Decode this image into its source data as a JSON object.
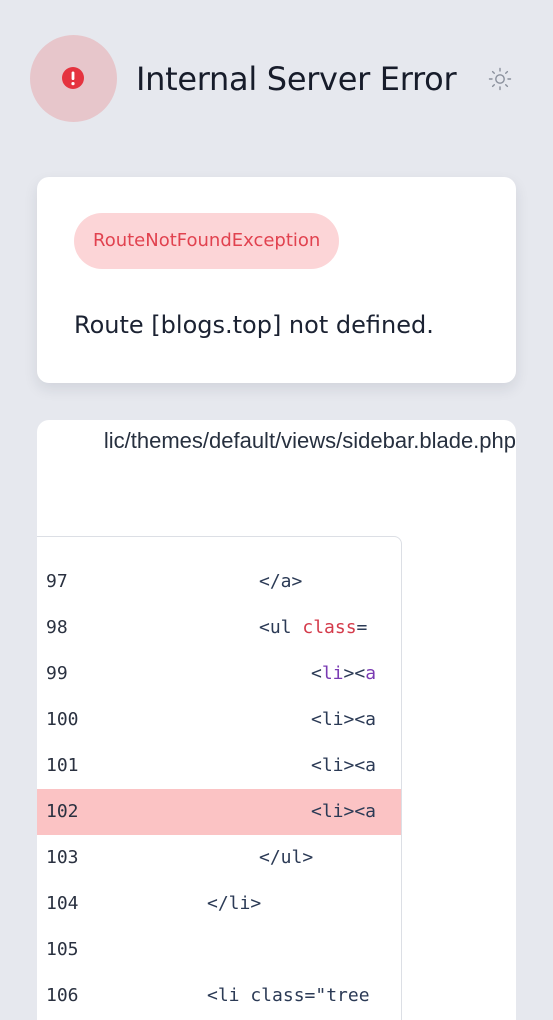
{
  "header": {
    "title": "Internal Server Error",
    "alert_icon": "exclamation-circle-icon",
    "theme_toggle_icon": "sun-icon",
    "accent_color": "#e7c6cb"
  },
  "exception": {
    "class_name": "RouteNotFoundException",
    "message": "Route [blogs.top] not defined.",
    "badge_bg": "#fcd5d7",
    "badge_color": "#e1424f"
  },
  "code_viewer": {
    "file_path": "lic/themes/default/views/sidebar.blade.php",
    "file_line_fragment": ":",
    "highlight_color": "#fbc3c4",
    "highlighted_line": "102",
    "lines": [
      {
        "number": "97",
        "code": "        </a>"
      },
      {
        "number": "98",
        "code": "        <ul class="
      },
      {
        "number": "99",
        "code": "            <li><a"
      },
      {
        "number": "100",
        "code": "            <li><a"
      },
      {
        "number": "101",
        "code": "            <li><a"
      },
      {
        "number": "102",
        "code": "            <li><a"
      },
      {
        "number": "103",
        "code": "        </ul>"
      },
      {
        "number": "104",
        "code": "    </li>"
      },
      {
        "number": "105",
        "code": ""
      },
      {
        "number": "106",
        "code": "    <li class=\"tree"
      }
    ]
  }
}
